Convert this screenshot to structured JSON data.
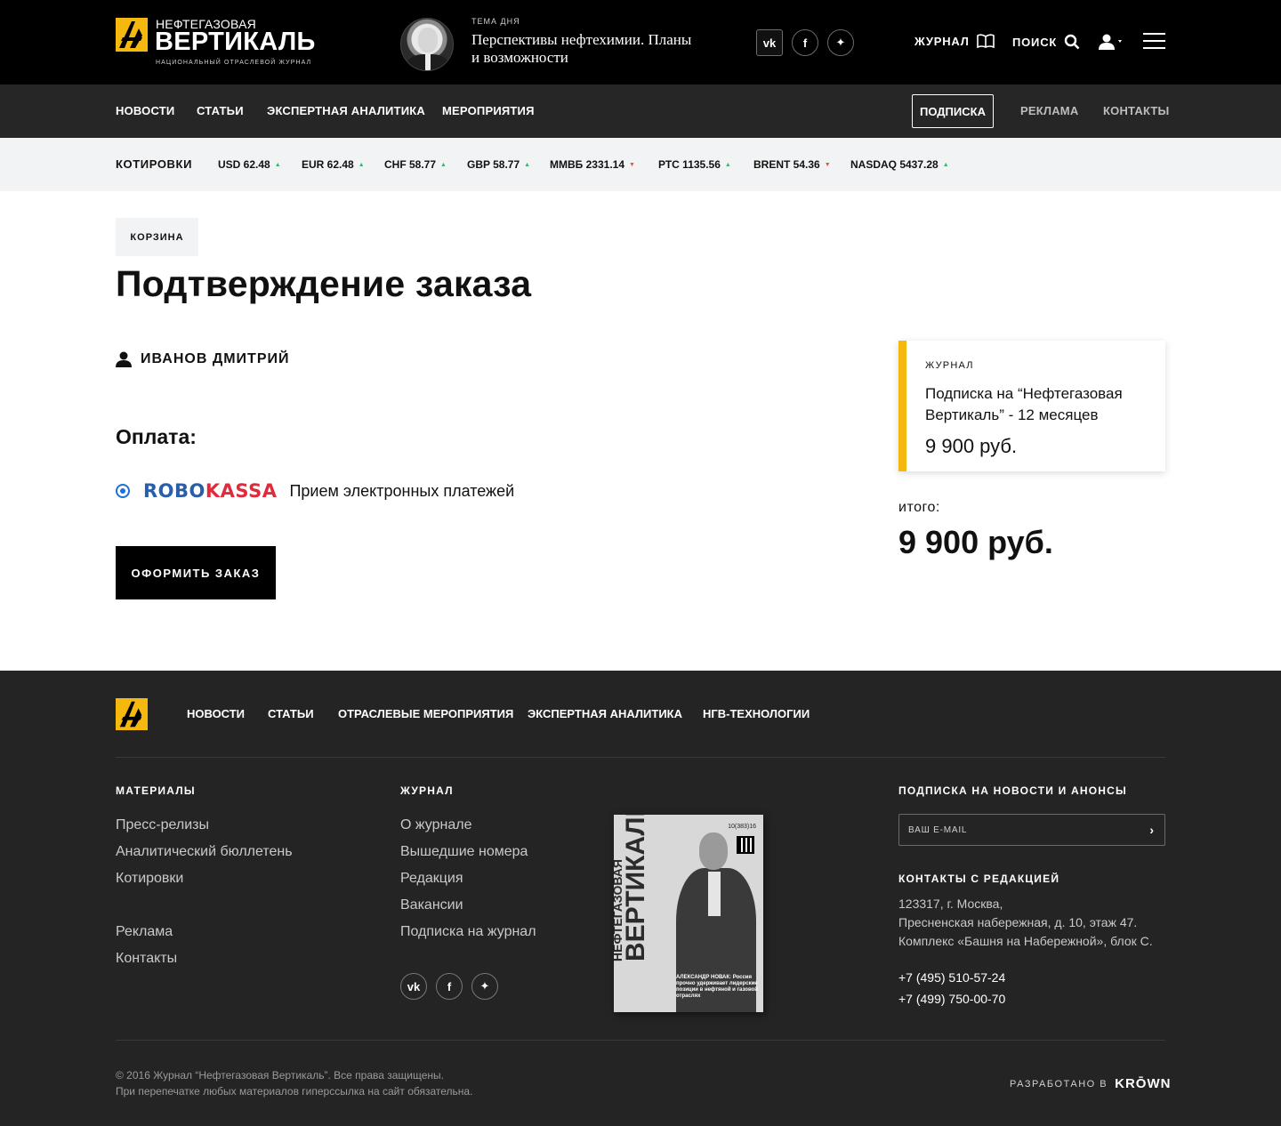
{
  "header": {
    "logo": {
      "small": "НЕФТЕГАЗОВАЯ",
      "big": "ВЕРТИКАЛЬ",
      "sub": "НАЦИОНАЛЬНЫЙ ОТРАСЛЕВОЙ ЖУРНАЛ"
    },
    "topic": {
      "label": "ТЕМА ДНЯ",
      "title": "Перспективы нефтехимии. Планы и возможности"
    },
    "social": [
      {
        "icon": "vk-icon",
        "text": "vk"
      },
      {
        "icon": "facebook-icon",
        "text": "f"
      },
      {
        "icon": "twitter-icon",
        "text": "t"
      }
    ],
    "journal_label": "ЖУРНАЛ",
    "search_label": "ПОИСК"
  },
  "nav": {
    "items": [
      "НОВОСТИ",
      "СТАТЬИ",
      "ЭКСПЕРТНАЯ АНАЛИТИКА",
      "МЕРОПРИЯТИЯ"
    ],
    "subscribe": "ПОДПИСКА",
    "right": [
      "РЕКЛАМА",
      "КОНТАКТЫ"
    ]
  },
  "quotes": {
    "label": "КОТИРОВКИ",
    "items": [
      {
        "text": "USD 62.48",
        "dir": "up"
      },
      {
        "text": "EUR 62.48",
        "dir": "up"
      },
      {
        "text": "CHF 58.77",
        "dir": "up"
      },
      {
        "text": "GBP 58.77",
        "dir": "up"
      },
      {
        "text": "ММВБ 2331.14",
        "dir": "down"
      },
      {
        "text": "РТС 1135.56",
        "dir": "up"
      },
      {
        "text": "BRENT 54.36",
        "dir": "down"
      },
      {
        "text": "NASDAQ 5437.28",
        "dir": "up"
      }
    ],
    "colors": {
      "up": "#3cb371",
      "down": "#e05a2b"
    }
  },
  "main": {
    "breadcrumb": "КОРЗИНА",
    "title": "Подтверждение заказа",
    "user_name": "ИВАНОВ ДМИТРИЙ",
    "payment_title": "Оплата:",
    "payment": {
      "logo_robo": "ROBO",
      "logo_kassa": "KASSA",
      "description": "Прием электронных платежей",
      "selected": true
    },
    "order_button": "ОФОРМИТЬ ЗАКАЗ"
  },
  "cart": {
    "category": "ЖУРНАЛ",
    "name": "Подписка на “Нефтегазовая Вертикаль” - 12 месяцев",
    "price": "9 900 руб.",
    "total_label": "итого:",
    "total": "9 900 руб.",
    "accent": "#f5b80f"
  },
  "footer": {
    "nav": [
      "НОВОСТИ",
      "СТАТЬИ",
      "ОТРАСЛЕВЫЕ МЕРОПРИЯТИЯ",
      "ЭКСПЕРТНАЯ АНАЛИТИКА",
      "НГВ-ТЕХНОЛОГИИ"
    ],
    "materials": {
      "title": "МАТЕРИАЛЫ",
      "links": [
        "Пресс-релизы",
        "Аналитический бюллетень",
        "Котировки",
        "Реклама",
        "Контакты"
      ]
    },
    "journal": {
      "title": "ЖУРНАЛ",
      "links": [
        "О журнале",
        "Вышедшие номера",
        "Редакция",
        "Вакансии",
        "Подписка на журнал"
      ]
    },
    "cover": {
      "title_small": "НЕФТЕГАЗОВАЯ",
      "title_big": "ВЕРТИКАЛЬ",
      "issue": "10(383)16",
      "caption": "АЛЕКСАНДР НОВАК: Россия прочно удерживает лидерские позиции в нефтяной и газовой отраслях"
    },
    "subscribe": {
      "title": "ПОДПИСКА НА НОВОСТИ И АНОНСЫ",
      "placeholder": "ВАШ E-MAIL"
    },
    "contacts": {
      "title": "КОНТАКТЫ С РЕДАКЦИЕЙ",
      "address": [
        "123317, г. Москва,",
        "Пресненская набережная, д. 10, этаж 47.",
        "Комплекс «Башня на Набережной», блок С."
      ],
      "phones": [
        "+7 (495) 510-57-24",
        "+7 (499) 750-00-70"
      ]
    },
    "copyright": [
      "© 2016 Журнал “Нефтегазовая Вертикаль”. Все права защищены.",
      "При перепечатке любых материалов гиперссылка на сайт обязательна."
    ],
    "developed_label": "РАЗРАБОТАНО В",
    "developer": "KRŌWN"
  }
}
